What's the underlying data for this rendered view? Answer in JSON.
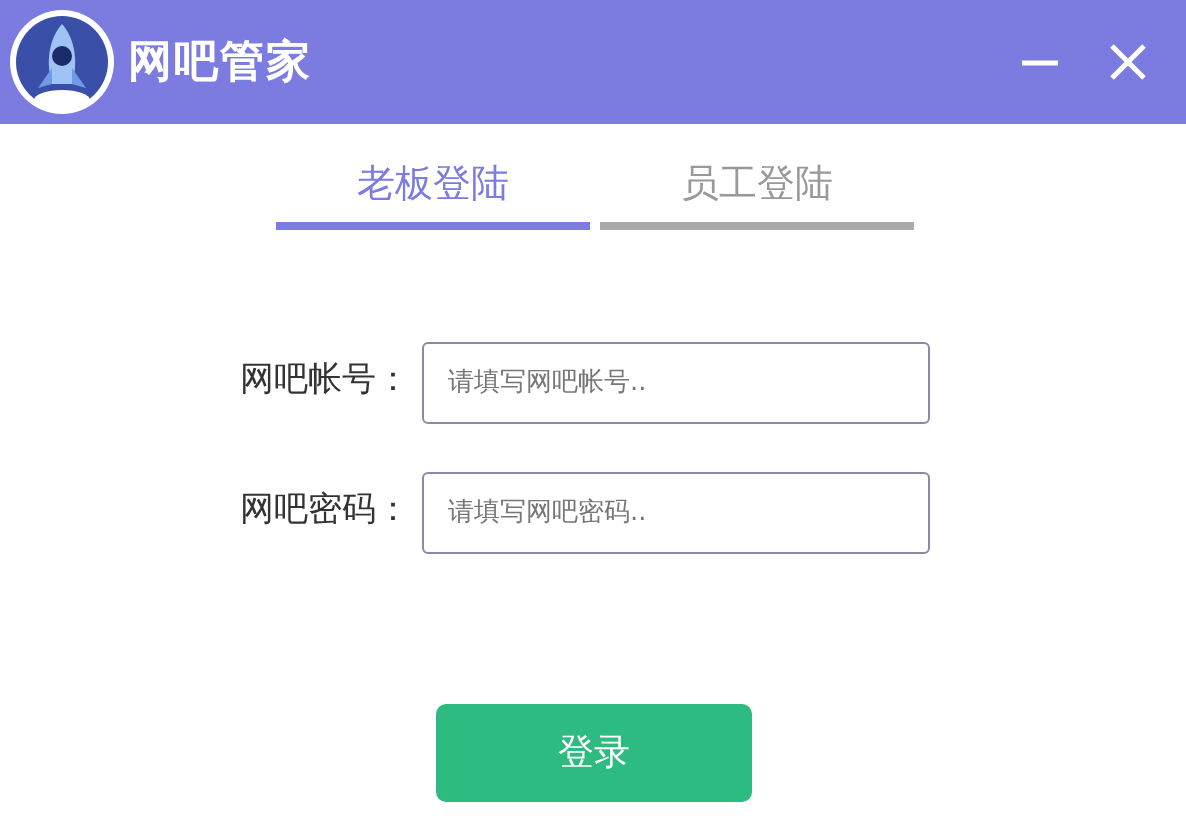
{
  "window": {
    "title": "网吧管家"
  },
  "tabs": [
    {
      "label": "老板登陆",
      "selected": true
    },
    {
      "label": "员工登陆",
      "selected": false
    }
  ],
  "fields": [
    {
      "label": "网吧帐号：",
      "placeholder": "请填写网吧帐号.."
    },
    {
      "label": "网吧密码：",
      "placeholder": "请填写网吧密码.."
    }
  ],
  "login_button": "登录"
}
